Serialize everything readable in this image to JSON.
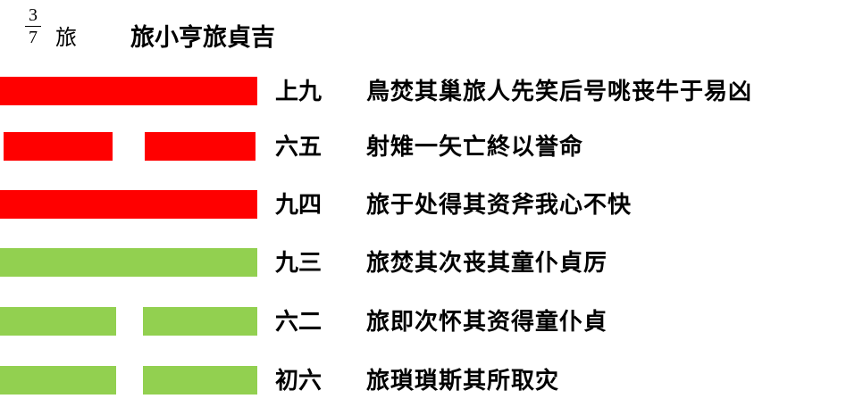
{
  "header": {
    "numerator": "3",
    "denominator": "7",
    "hexagram_name": "旅",
    "judgment": "旅小亨旅貞吉"
  },
  "colors": {
    "yang_red": "#ff0000",
    "yin_green": "#92d050"
  },
  "lines": [
    {
      "position": "上九",
      "text": "鳥焚其巢旅人先笑后号咷丧牛于易凶",
      "type": "yang",
      "color": "#ff0000"
    },
    {
      "position": "六五",
      "text": "射雉一矢亡終以誉命",
      "type": "yin",
      "color": "#ff0000"
    },
    {
      "position": "九四",
      "text": "旅于处得其资斧我心不快",
      "type": "yang",
      "color": "#ff0000"
    },
    {
      "position": "九三",
      "text": "旅焚其次丧其童仆貞厉",
      "type": "yang",
      "color": "#92d050"
    },
    {
      "position": "六二",
      "text": "旅即次怀其资得童仆貞",
      "type": "yin",
      "color": "#92d050"
    },
    {
      "position": "初六",
      "text": "旅瑣瑣斯其所取灾",
      "type": "yin",
      "color": "#92d050"
    }
  ]
}
